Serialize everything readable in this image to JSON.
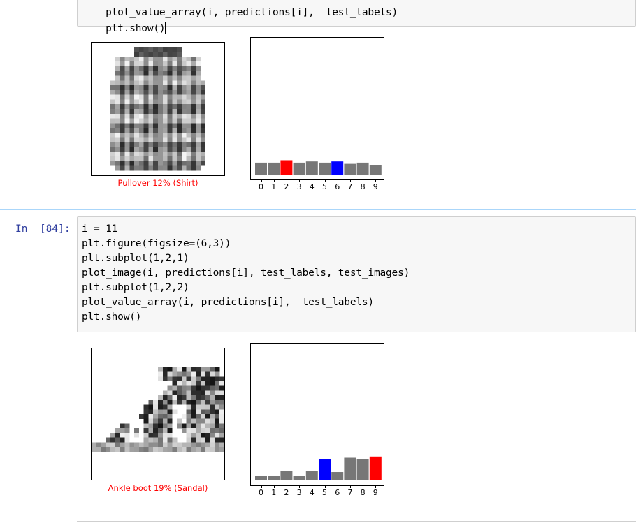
{
  "cells": [
    {
      "prompt": "",
      "code_lines": [
        "plot_value_array(i, predictions[i],  test_labels)",
        "plt.show()"
      ],
      "output": {
        "caption": "Pullover 12% (Shirt)",
        "caption_color": "#ff0000",
        "image_subject": "shirt",
        "chart_data": {
          "type": "bar",
          "categories": [
            "0",
            "1",
            "2",
            "3",
            "4",
            "5",
            "6",
            "7",
            "8",
            "9"
          ],
          "values": [
            0.1,
            0.1,
            0.12,
            0.1,
            0.11,
            0.1,
            0.11,
            0.09,
            0.1,
            0.08
          ],
          "colors": [
            "#777777",
            "#777777",
            "#ff0000",
            "#777777",
            "#777777",
            "#777777",
            "#0000ff",
            "#777777",
            "#777777",
            "#777777"
          ],
          "ylim": [
            0,
            1
          ],
          "xlabel": "",
          "ylabel": "",
          "grid": false
        }
      }
    },
    {
      "prompt": "In  [84]:",
      "code_lines": [
        "i = 11",
        "plt.figure(figsize=(6,3))",
        "plt.subplot(1,2,1)",
        "plot_image(i, predictions[i], test_labels, test_images)",
        "plt.subplot(1,2,2)",
        "plot_value_array(i, predictions[i],  test_labels)",
        "plt.show()"
      ],
      "output": {
        "caption": "Ankle boot 19% (Sandal)",
        "caption_color": "#ff0000",
        "image_subject": "sandal",
        "chart_data": {
          "type": "bar",
          "categories": [
            "0",
            "1",
            "2",
            "3",
            "4",
            "5",
            "6",
            "7",
            "8",
            "9"
          ],
          "values": [
            0.04,
            0.04,
            0.08,
            0.04,
            0.08,
            0.18,
            0.07,
            0.19,
            0.18,
            0.2
          ],
          "colors": [
            "#777777",
            "#777777",
            "#777777",
            "#777777",
            "#777777",
            "#0000ff",
            "#777777",
            "#777777",
            "#777777",
            "#ff0000"
          ],
          "ylim": [
            0,
            1
          ],
          "xlabel": "",
          "ylabel": "",
          "grid": false
        }
      }
    }
  ]
}
